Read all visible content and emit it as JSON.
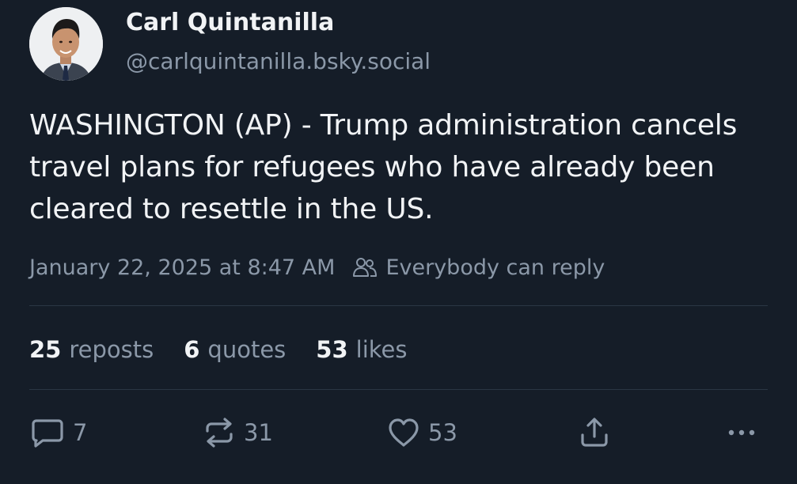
{
  "author": {
    "display_name": "Carl Quintanilla",
    "handle": "@carlquintanilla.bsky.social",
    "avatar_icon": "profile-photo"
  },
  "post": {
    "text": "WASHINGTON (AP) - Trump administration cancels travel plans for refugees who have already been cleared to resettle in the US.",
    "timestamp": "January 22, 2025 at 8:47 AM",
    "reply_setting": "Everybody can reply"
  },
  "stats": {
    "reposts_count": "25",
    "reposts_label": "reposts",
    "quotes_count": "6",
    "quotes_label": "quotes",
    "likes_count": "53",
    "likes_label": "likes"
  },
  "actions": {
    "reply_count": "7",
    "repost_count": "31",
    "like_count": "53"
  },
  "colors": {
    "background": "#151d28",
    "text_primary": "#f1f3f5",
    "text_secondary": "#8b98a8",
    "divider": "#2a3644"
  }
}
